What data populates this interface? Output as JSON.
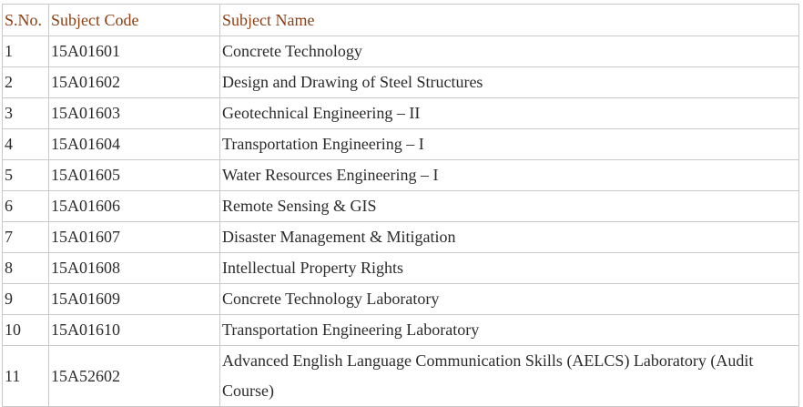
{
  "table": {
    "headers": [
      "S.No.",
      "Subject Code",
      "Subject Name"
    ],
    "rows": [
      {
        "sno": "1",
        "code": "15A01601",
        "name": "Concrete Technology"
      },
      {
        "sno": "2",
        "code": "15A01602",
        "name": "Design and Drawing of Steel Structures"
      },
      {
        "sno": "3",
        "code": "15A01603",
        "name": "Geotechnical Engineering – II"
      },
      {
        "sno": "4",
        "code": "15A01604",
        "name": "Transportation Engineering – I"
      },
      {
        "sno": "5",
        "code": "15A01605",
        "name": "Water Resources Engineering – I"
      },
      {
        "sno": "6",
        "code": "15A01606",
        "name": "Remote Sensing & GIS"
      },
      {
        "sno": "7",
        "code": "15A01607",
        "name": "Disaster Management & Mitigation"
      },
      {
        "sno": "8",
        "code": "15A01608",
        "name": "Intellectual Property Rights"
      },
      {
        "sno": "9",
        "code": "15A01609",
        "name": "Concrete Technology Laboratory"
      },
      {
        "sno": "10",
        "code": "15A01610",
        "name": "Transportation Engineering Laboratory"
      },
      {
        "sno": "11",
        "code": "15A52602",
        "name": "Advanced English Language Communication Skills (AELCS) Laboratory (Audit Course)"
      }
    ]
  }
}
